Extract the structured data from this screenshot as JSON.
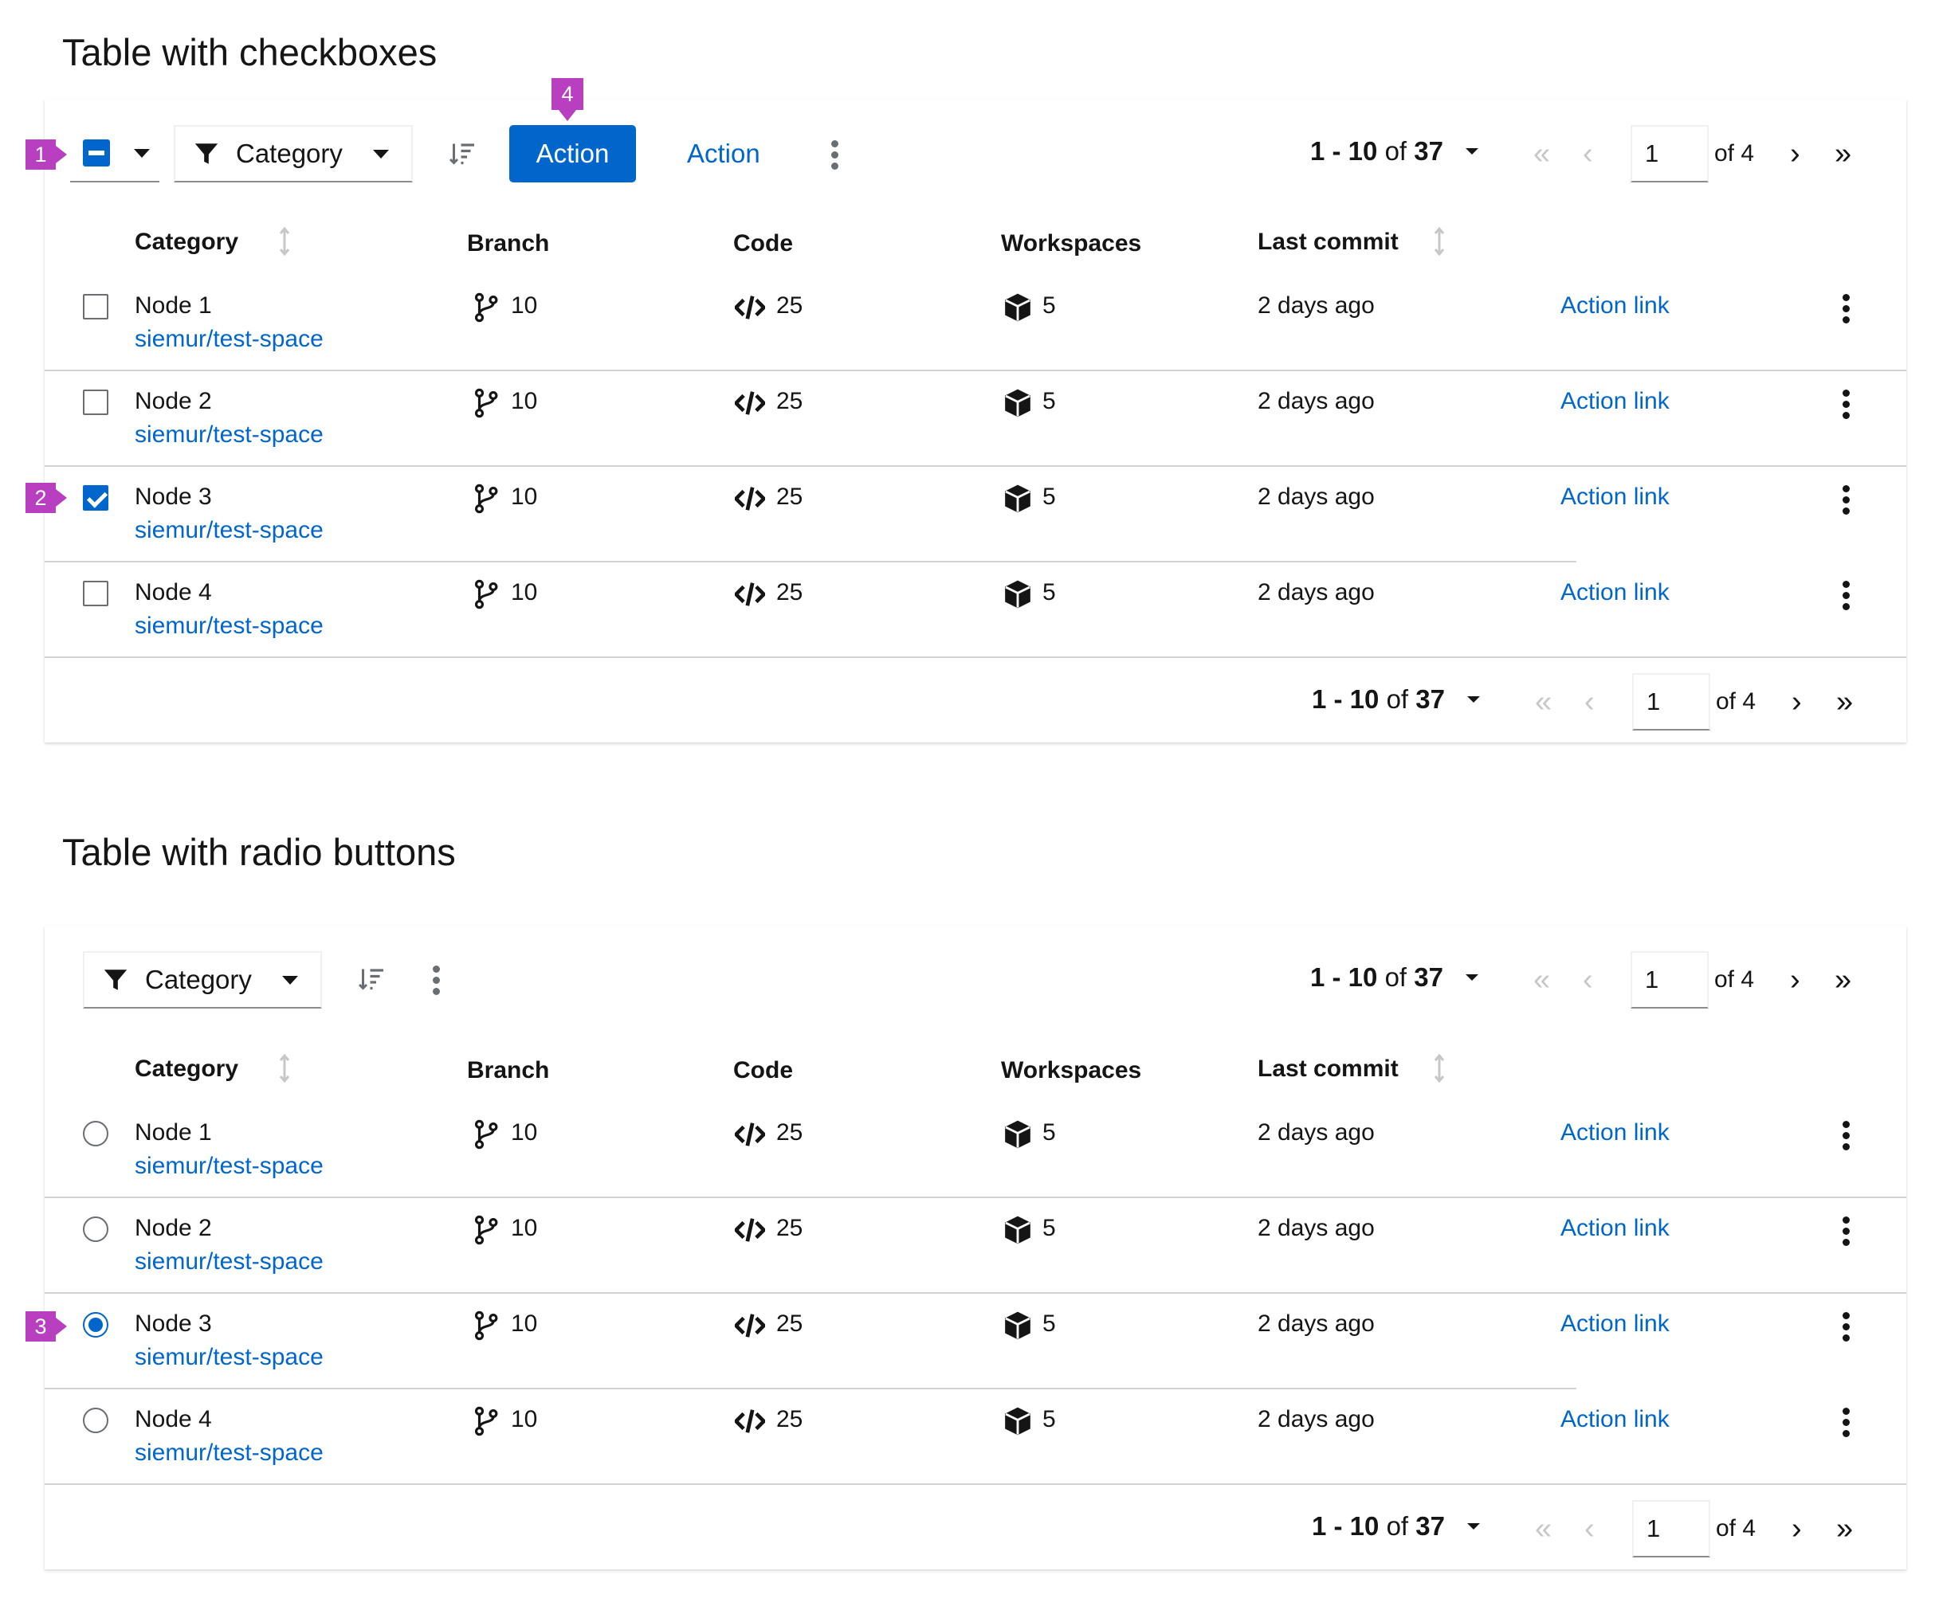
{
  "sections": [
    {
      "title": "Table with checkboxes",
      "toolbar": {
        "filter_label": "Category",
        "primary_action": "Action",
        "secondary_action": "Action"
      },
      "pagination_top": {
        "range": "1 - 10",
        "of_word": "of",
        "total": "37",
        "page": "1",
        "page_of": "of 4"
      },
      "pagination_bottom": {
        "range": "1 - 10",
        "of_word": "of",
        "total": "37",
        "page": "1",
        "page_of": "of 4"
      },
      "columns": {
        "category": "Category",
        "branch": "Branch",
        "code": "Code",
        "workspaces": "Workspaces",
        "last_commit": "Last commit"
      },
      "rows": [
        {
          "name": "Node 1",
          "sub": "siemur/test-space",
          "branch": "10",
          "code": "25",
          "workspaces": "5",
          "last_commit": "2 days ago",
          "action": "Action link",
          "selected": false
        },
        {
          "name": "Node 2",
          "sub": "siemur/test-space",
          "branch": "10",
          "code": "25",
          "workspaces": "5",
          "last_commit": "2 days ago",
          "action": "Action link",
          "selected": false
        },
        {
          "name": "Node 3",
          "sub": "siemur/test-space",
          "branch": "10",
          "code": "25",
          "workspaces": "5",
          "last_commit": "2 days ago",
          "action": "Action link",
          "selected": true
        },
        {
          "name": "Node 4",
          "sub": "siemur/test-space",
          "branch": "10",
          "code": "25",
          "workspaces": "5",
          "last_commit": "2 days ago",
          "action": "Action link",
          "selected": false
        }
      ]
    },
    {
      "title": "Table with radio buttons",
      "toolbar": {
        "filter_label": "Category"
      },
      "pagination_top": {
        "range": "1 - 10",
        "of_word": "of",
        "total": "37",
        "page": "1",
        "page_of": "of 4"
      },
      "pagination_bottom": {
        "range": "1 - 10",
        "of_word": "of",
        "total": "37",
        "page": "1",
        "page_of": "of 4"
      },
      "columns": {
        "category": "Category",
        "branch": "Branch",
        "code": "Code",
        "workspaces": "Workspaces",
        "last_commit": "Last commit"
      },
      "rows": [
        {
          "name": "Node 1",
          "sub": "siemur/test-space",
          "branch": "10",
          "code": "25",
          "workspaces": "5",
          "last_commit": "2 days ago",
          "action": "Action link",
          "selected": false
        },
        {
          "name": "Node 2",
          "sub": "siemur/test-space",
          "branch": "10",
          "code": "25",
          "workspaces": "5",
          "last_commit": "2 days ago",
          "action": "Action link",
          "selected": false
        },
        {
          "name": "Node 3",
          "sub": "siemur/test-space",
          "branch": "10",
          "code": "25",
          "workspaces": "5",
          "last_commit": "2 days ago",
          "action": "Action link",
          "selected": true
        },
        {
          "name": "Node 4",
          "sub": "siemur/test-space",
          "branch": "10",
          "code": "25",
          "workspaces": "5",
          "last_commit": "2 days ago",
          "action": "Action link",
          "selected": false
        }
      ]
    }
  ],
  "callouts": [
    "1",
    "2",
    "3",
    "4"
  ],
  "icons": {
    "filter": "funnel-icon",
    "sort": "sort-amount-down-icon",
    "branch": "code-branch-icon",
    "code": "code-icon",
    "workspaces": "cube-icon",
    "kebab": "ellipsis-v-icon"
  },
  "colors": {
    "primary": "#0066cc",
    "callout": "#b83fbf",
    "text": "#151515",
    "disabled": "#c7c7c7"
  }
}
